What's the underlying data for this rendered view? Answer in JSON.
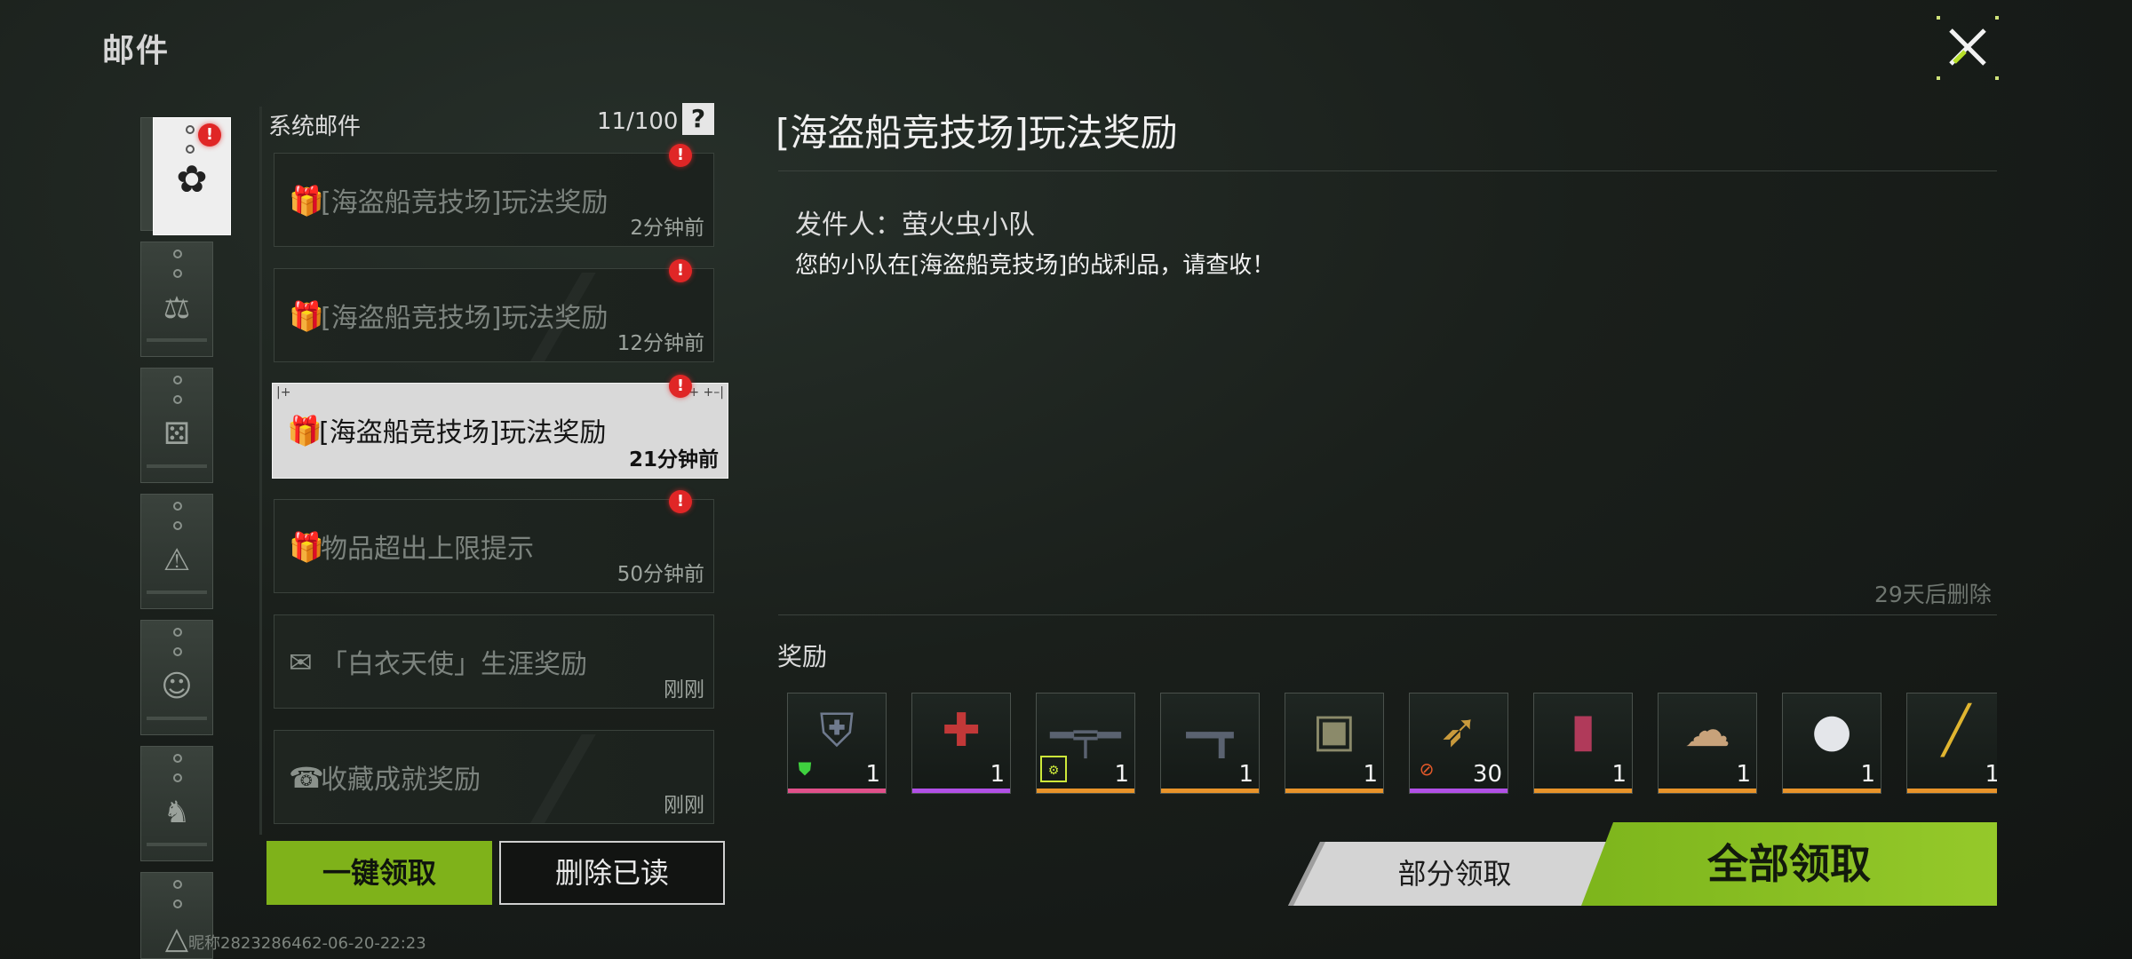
{
  "header": {
    "title": "邮件"
  },
  "mail_list": {
    "title": "系统邮件",
    "count": "11/100",
    "help_icon": "?",
    "items": [
      {
        "icon": "gift-icon",
        "title": "[海盗船竞技场]玩法奖励",
        "time": "2分钟前",
        "unread": true
      },
      {
        "icon": "gift-icon",
        "title": "[海盗船竞技场]玩法奖励",
        "time": "12分钟前",
        "unread": true
      },
      {
        "icon": "gift-icon",
        "title": "[海盗船竞技场]玩法奖励",
        "time": "21分钟前",
        "unread": true,
        "selected": true
      },
      {
        "icon": "gift-icon",
        "title": "物品超出上限提示",
        "time": "50分钟前",
        "unread": true
      },
      {
        "icon": "envelope-icon",
        "title": "「白衣天使」生涯奖励",
        "time": "刚刚",
        "unread": false
      },
      {
        "icon": "trophy-icon",
        "title": "收藏成就奖励",
        "time": "刚刚",
        "unread": false
      }
    ],
    "claim_all_label": "一键领取",
    "delete_read_label": "删除已读"
  },
  "nickname": "昵称2823286462-06-20-22:23",
  "detail": {
    "title": "[海盗船竞技场]玩法奖励",
    "sender": "发件人：萤火虫小队",
    "body": "您的小队在[海盗船竞技场]的战利品，请查收！",
    "expire": "29天后删除",
    "reward_label": "奖励",
    "rewards": [
      {
        "name": "armor-vest",
        "qty": "1",
        "rarity_color": "#e0508a"
      },
      {
        "name": "medkit",
        "qty": "1",
        "rarity_color": "#b150e6"
      },
      {
        "name": "assault-rifle",
        "qty": "1",
        "rarity_color": "#e8932a"
      },
      {
        "name": "smg",
        "qty": "1",
        "rarity_color": "#e8932a"
      },
      {
        "name": "backpack",
        "qty": "1",
        "rarity_color": "#e8932a"
      },
      {
        "name": "ammo",
        "qty": "30",
        "rarity_color": "#b150e6"
      },
      {
        "name": "canister",
        "qty": "1",
        "rarity_color": "#e8932a"
      },
      {
        "name": "ghillie-hood",
        "qty": "1",
        "rarity_color": "#e8932a"
      },
      {
        "name": "penguin-charm",
        "qty": "1",
        "rarity_color": "#e8932a"
      },
      {
        "name": "golden-pistol",
        "qty": "1",
        "rarity_color": "#e8932a"
      }
    ],
    "partial_claim_label": "部分领取",
    "claim_all_label": "全部领取"
  },
  "colors": {
    "accent": "#7fb21a",
    "badge": "#e02626",
    "selected_bg": "#d9d9d9"
  }
}
